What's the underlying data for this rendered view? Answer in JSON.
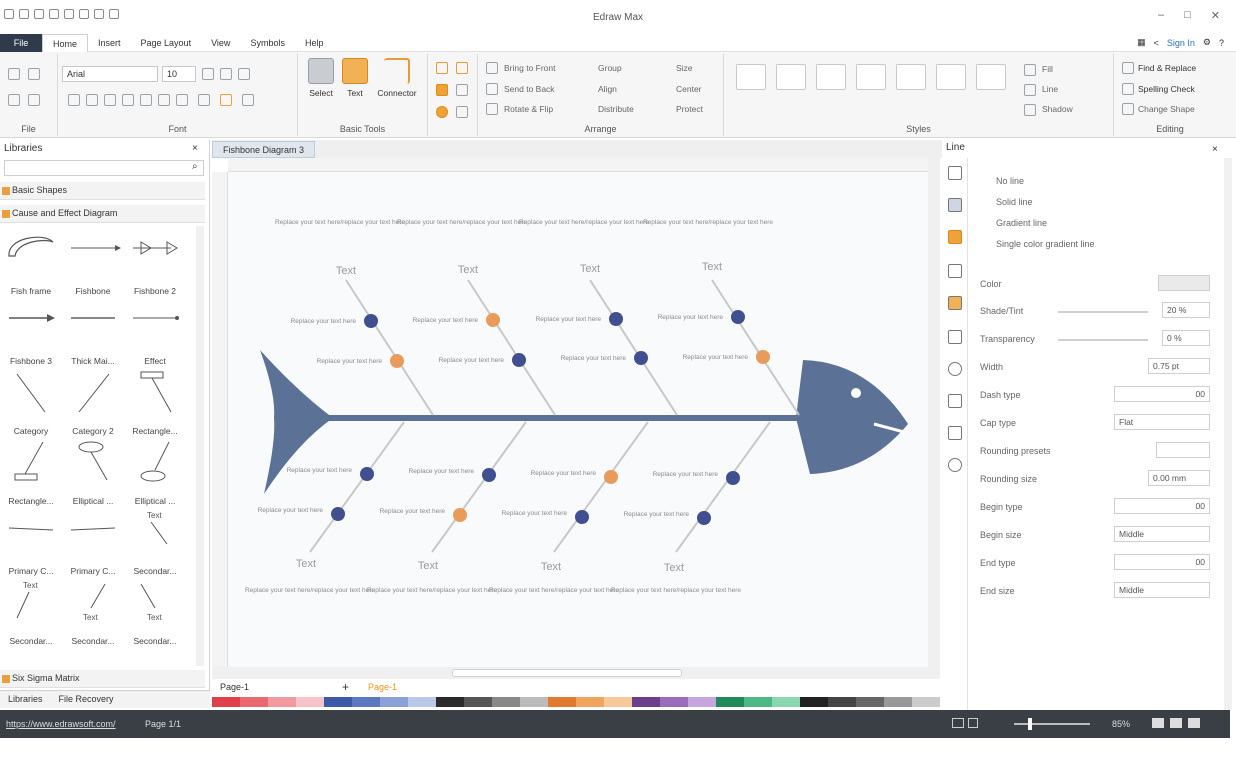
{
  "app": {
    "title": "Edraw Max",
    "account_link": "Sign In"
  },
  "menu": [
    "File",
    "Home",
    "Insert",
    "Page Layout",
    "View",
    "Symbols",
    "Help"
  ],
  "ribbon": {
    "groups": {
      "file": "File",
      "font": "Font",
      "basic_tools": "Basic Tools",
      "arrange": "Arrange",
      "styles": "Styles",
      "editing": "Editing"
    },
    "font_name": "Arial",
    "font_size": "10",
    "tools": {
      "select": "Select",
      "text": "Text",
      "connector": "Connector"
    },
    "arrange": [
      "Bring to Front",
      "Send to Back",
      "Rotate & Flip",
      "Group",
      "Align",
      "Distribute",
      "Size",
      "Center",
      "Protect"
    ],
    "fill_items": [
      "Fill",
      "Line",
      "Shadow"
    ],
    "editing": [
      "Find & Replace",
      "Spelling Check",
      "Change Shape"
    ]
  },
  "libraries": {
    "title": "Libraries",
    "sections": [
      "Basic Shapes",
      "Cause and Effect Diagram",
      "Six Sigma Matrix"
    ],
    "shapes": [
      "Fish frame",
      "Fishbone",
      "Fishbone 2",
      "Fishbone 3",
      "Thick Mai...",
      "Effect",
      "Category",
      "Category 2",
      "Rectangle...",
      "Rectangle...",
      "Elliptical ...",
      "Elliptical ...",
      "Primary C...",
      "Primary C...",
      "Secondar...",
      "Secondar...",
      "Secondar...",
      "Secondar..."
    ],
    "shape_texts": {
      "text": "Text"
    },
    "tabs": [
      "Libraries",
      "File Recovery"
    ]
  },
  "document": {
    "tab": "Fishbone Diagram 3"
  },
  "diagram": {
    "category_label": "Text",
    "cause_label": "Replace your text here",
    "category_desc": "Replace your text here/replace your text here"
  },
  "pages": {
    "current": "Page-1",
    "tab": "Page-1"
  },
  "line_panel": {
    "title": "Line",
    "options": [
      "No line",
      "Solid line",
      "Gradient line",
      "Single color gradient line"
    ],
    "rows": [
      {
        "label": "Color",
        "value": ""
      },
      {
        "label": "Shade/Tint",
        "value": "20 %"
      },
      {
        "label": "Transparency",
        "value": "0 %"
      },
      {
        "label": "Width",
        "value": "0.75 pt"
      },
      {
        "label": "Dash type",
        "value": "00"
      },
      {
        "label": "Cap type",
        "value": "Flat"
      },
      {
        "label": "Rounding presets",
        "value": ""
      },
      {
        "label": "Rounding size",
        "value": "0.00 mm"
      },
      {
        "label": "Begin type",
        "value": "00"
      },
      {
        "label": "Begin size",
        "value": "Middle"
      },
      {
        "label": "End type",
        "value": "00"
      },
      {
        "label": "End size",
        "value": "Middle"
      }
    ]
  },
  "status": {
    "url": "https://www.edrawsoft.com/",
    "page": "Page 1/1",
    "zoom": "85%"
  },
  "colors": {
    "navy": "#3f4f8f",
    "orange": "#e89b5a",
    "fish": "#5b7196",
    "statusbar": "#3a3f45",
    "accent": "#e8a13c"
  }
}
